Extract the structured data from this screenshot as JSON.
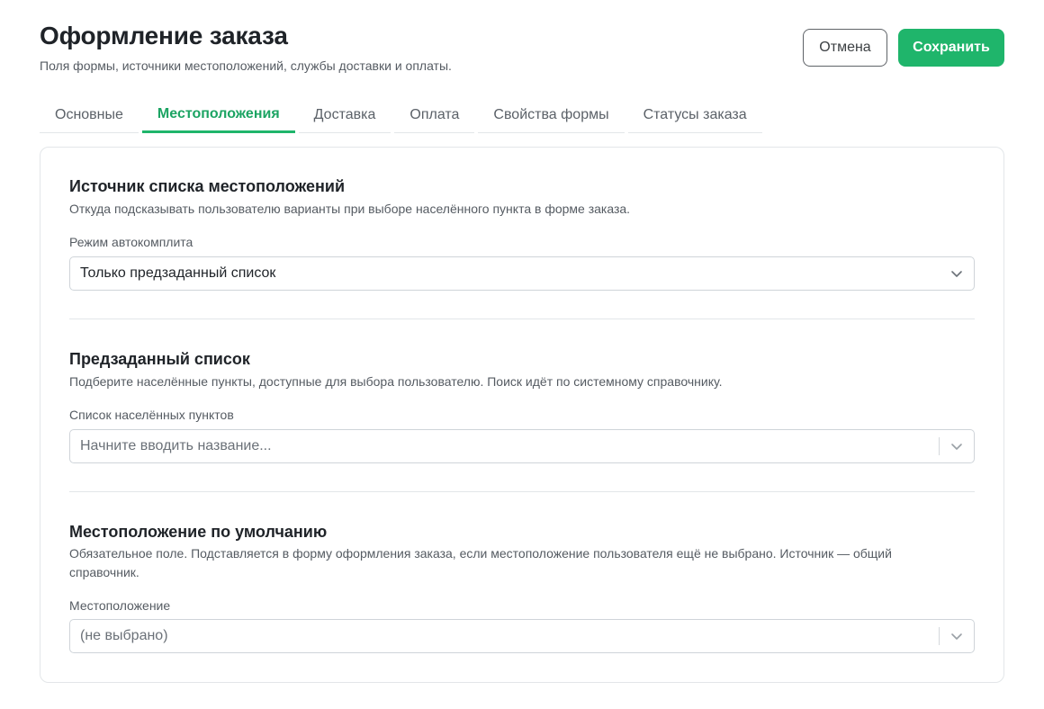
{
  "header": {
    "title": "Оформление заказа",
    "subtitle": "Поля формы, источники местоположений, службы доставки и оплаты.",
    "cancel_label": "Отмена",
    "save_label": "Сохранить"
  },
  "tabs": [
    {
      "label": "Основные",
      "active": false
    },
    {
      "label": "Местоположения",
      "active": true
    },
    {
      "label": "Доставка",
      "active": false
    },
    {
      "label": "Оплата",
      "active": false
    },
    {
      "label": "Свойства формы",
      "active": false
    },
    {
      "label": "Статусы заказа",
      "active": false
    }
  ],
  "sections": {
    "source": {
      "title": "Источник списка местоположений",
      "description": "Откуда подсказывать пользователю варианты при выборе населённого пункта в форме заказа.",
      "field_label": "Режим автокомплита",
      "field_value": "Только предзаданный список"
    },
    "preset": {
      "title": "Предзаданный список",
      "description": "Подберите населённые пункты, доступные для выбора пользователю. Поиск идёт по системному справочнику.",
      "field_label": "Список населённых пунктов",
      "field_placeholder": "Начните вводить название..."
    },
    "default": {
      "title": "Местоположение по умолчанию",
      "description": "Обязательное поле. Подставляется в форму оформления заказа, если местоположение пользователя ещё не выбрано. Источник — общий справочник.",
      "field_label": "Местоположение",
      "field_value": "(не выбрано)"
    }
  },
  "icons": {
    "select_chevron": "chevron-down-icon"
  },
  "colors": {
    "accent": "#1fb56b",
    "accent_text": "#1ca463",
    "border": "#e3e6e9",
    "text": "#1f2328",
    "muted": "#555b62"
  }
}
